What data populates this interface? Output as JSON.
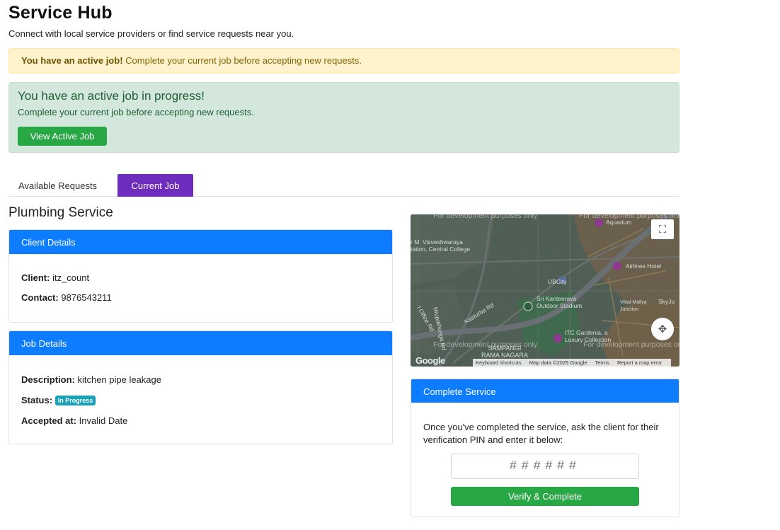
{
  "header": {
    "title": "Service Hub",
    "subtitle": "Connect with local service providers or find service requests near you."
  },
  "warning_alert": {
    "bold": "You have an active job!",
    "text": " Complete your current job before accepting new requests."
  },
  "active_job_alert": {
    "heading": "You have an active job in progress!",
    "message": "Complete your current job before accepting new requests.",
    "button_label": "View Active Job"
  },
  "tabs": [
    {
      "label": "Available Requests",
      "active": false
    },
    {
      "label": "Current Job",
      "active": true
    }
  ],
  "service_title": "Plumbing Service",
  "client_details": {
    "header": "Client Details",
    "client_label": "Client:",
    "client_value": "itz_count",
    "contact_label": "Contact:",
    "contact_value": "9876543211"
  },
  "job_details": {
    "header": "Job Details",
    "description_label": "Description:",
    "description_value": "kitchen pipe leakage",
    "status_label": "Status:",
    "status_value": "In Progress",
    "accepted_label": "Accepted at:",
    "accepted_value": "Invalid Date"
  },
  "map": {
    "dev_text": "For development purposes only",
    "labels": {
      "college": "r M. Visveshwaraya\ntation, Central College",
      "aquarium": "Aquarium",
      "airlines_hotel": "Airlines Hotel",
      "ubcity": "UBCity",
      "stadium": "Sri Kanteerava\nOutdoor Stadium",
      "vittal": "Vittal Mallya\nJunction",
      "skyju": "SkyJu",
      "nrupathunga": "Nrupathunga Rd",
      "kasturba": "Kasturba Rd",
      "office_rd": "l Office Rd",
      "itc": "ITC Gardenia, a\nLuxury Collection",
      "sampangi": "SAMPANGI\nRAMA NAGARA"
    },
    "google": "Google",
    "footer": [
      "Keyboard shortcuts",
      "Map data ©2025 Google",
      "Terms",
      "Report a map error"
    ]
  },
  "complete_service": {
    "header": "Complete Service",
    "instructions": "Once you've completed the service, ask the client for their verification PIN and enter it below:",
    "pin_placeholder": "######",
    "button_label": "Verify & Complete"
  },
  "colors": {
    "primary": "#0d7cff",
    "success": "#28a745",
    "tab_active": "#6f2dbd",
    "badge": "#17a2b8"
  }
}
